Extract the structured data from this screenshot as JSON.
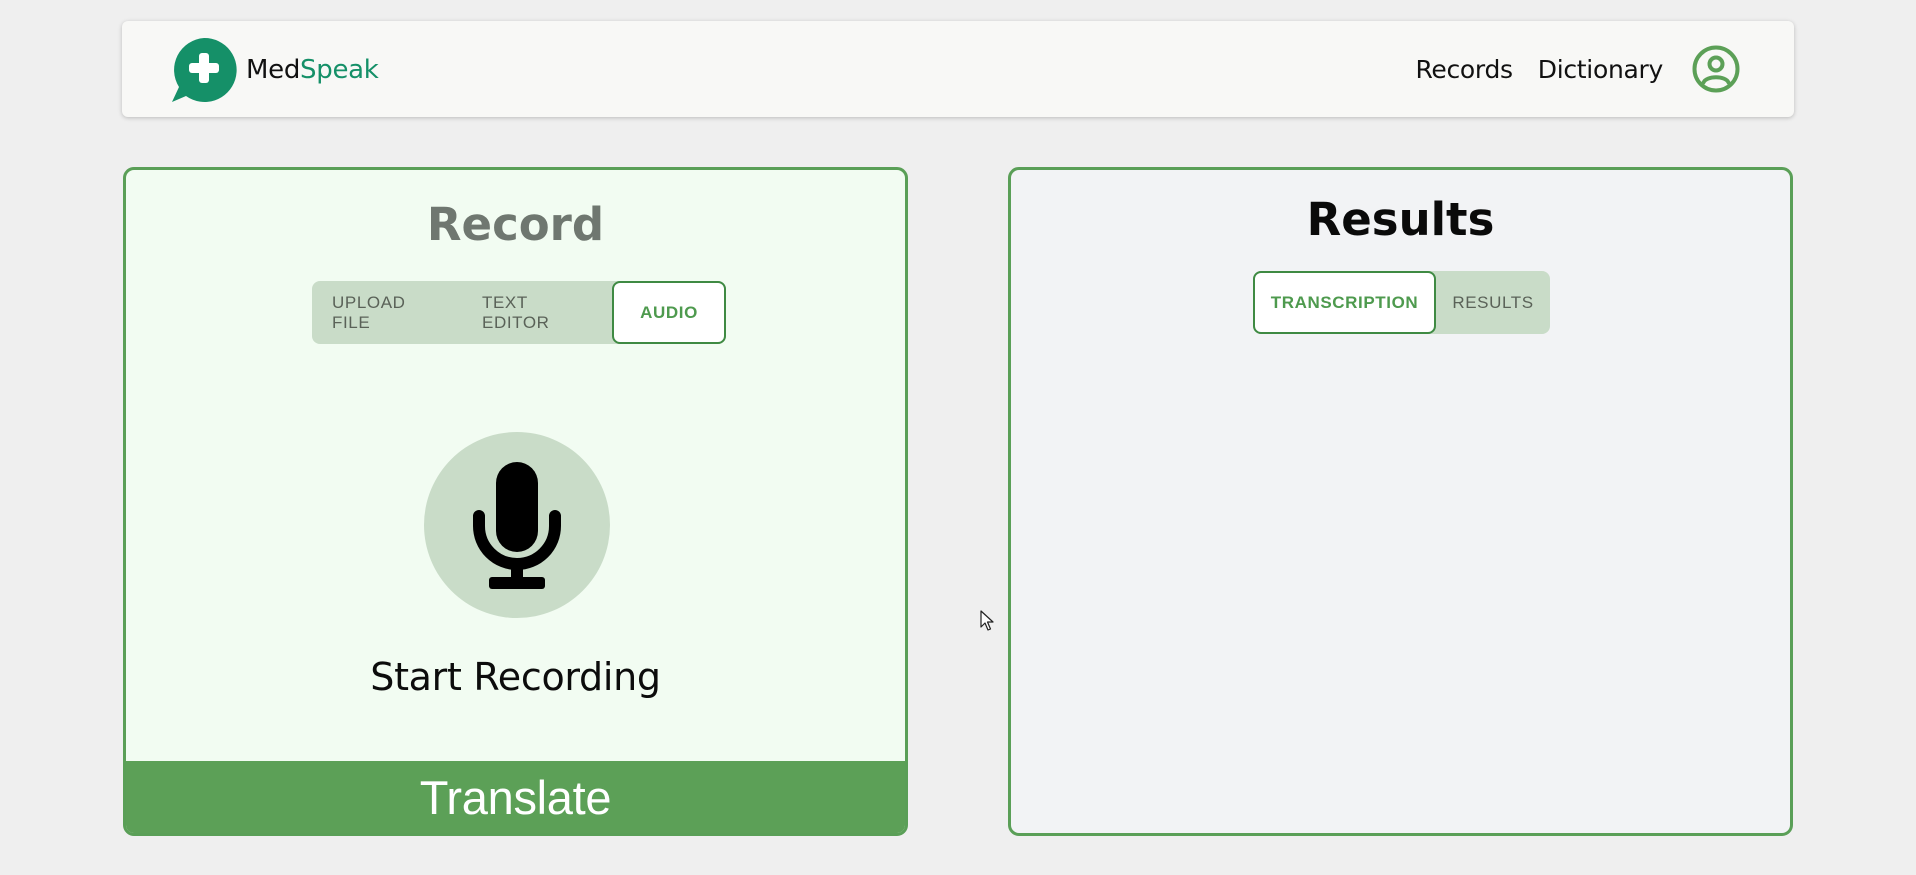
{
  "header": {
    "brand_prefix": "Med",
    "brand_suffix": "Speak",
    "brand_color": "#159068",
    "logo_icon": "speech-bubble-plus-icon",
    "nav": [
      {
        "label": "Records"
      },
      {
        "label": "Dictionary"
      }
    ],
    "profile_icon": "user-circle-icon"
  },
  "record_panel": {
    "title": "Record",
    "tabs": [
      {
        "label": "UPLOAD FILE",
        "active": false
      },
      {
        "label": "TEXT EDITOR",
        "active": false
      },
      {
        "label": "AUDIO",
        "active": true
      }
    ],
    "mic_icon": "microphone-icon",
    "start_label": "Start Recording",
    "translate_label": "Translate"
  },
  "results_panel": {
    "title": "Results",
    "tabs": [
      {
        "label": "TRANSCRIPTION",
        "active": true
      },
      {
        "label": "RESULTS",
        "active": false
      }
    ],
    "content": ""
  },
  "colors": {
    "accent_green": "#5ca057",
    "border_green": "#5a9f57",
    "tab_bg": "#c9dcc8",
    "record_bg": "#f2fcf2",
    "results_bg": "#f2f3f5"
  }
}
